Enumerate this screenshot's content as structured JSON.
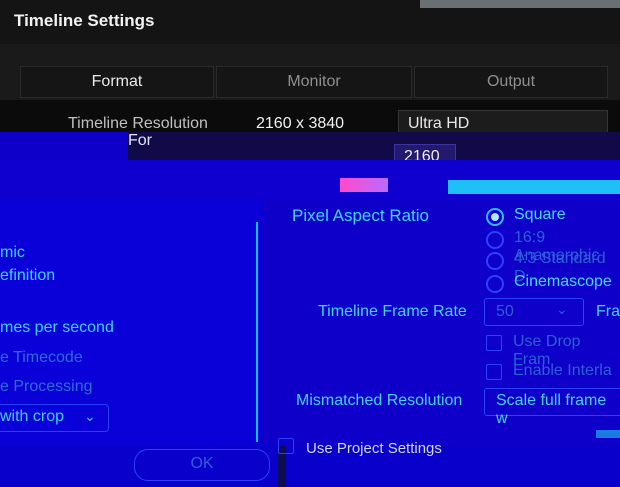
{
  "window": {
    "title": "Timeline Settings"
  },
  "tabs": [
    {
      "label": "Format",
      "active": true
    },
    {
      "label": "Monitor",
      "active": false
    },
    {
      "label": "Output",
      "active": false
    }
  ],
  "format": {
    "timeline_resolution_label": "Timeline Resolution",
    "timeline_resolution_value": "2160 x 3840",
    "timeline_resolution_preset": "Ultra HD",
    "for_label": "For",
    "for_value": "2160"
  },
  "left_panel": {
    "items": [
      {
        "text": "mic",
        "dim": false
      },
      {
        "text": "efinition",
        "dim": false
      },
      {
        "text": "mes per second",
        "dim": false
      },
      {
        "text": "e Timecode",
        "dim": true
      },
      {
        "text": "e Processing",
        "dim": true
      }
    ],
    "crop_select": {
      "value": "with crop"
    }
  },
  "pixel_aspect_ratio": {
    "label": "Pixel Aspect Ratio",
    "options": [
      {
        "label": "Square",
        "selected": true,
        "enabled": true
      },
      {
        "label": "16:9 Anamorphic",
        "selected": false,
        "enabled": false
      },
      {
        "label": "4:3 Standard D",
        "selected": false,
        "enabled": false
      },
      {
        "label": "Cinemascope",
        "selected": false,
        "enabled": true
      }
    ]
  },
  "frame_rate": {
    "label": "Timeline Frame Rate",
    "value": "50",
    "unit_text": "Fra",
    "drop_frame": "Use Drop Fram",
    "interlace": "Enable Interla"
  },
  "mismatched": {
    "label": "Mismatched Resolution",
    "value": "Scale full frame w"
  },
  "footer": {
    "use_project_settings": "Use Project Settings",
    "ok": "OK"
  },
  "colors": {
    "background": "#0e00c8",
    "accent": "#43d4ff",
    "titlebar": "#141414"
  }
}
